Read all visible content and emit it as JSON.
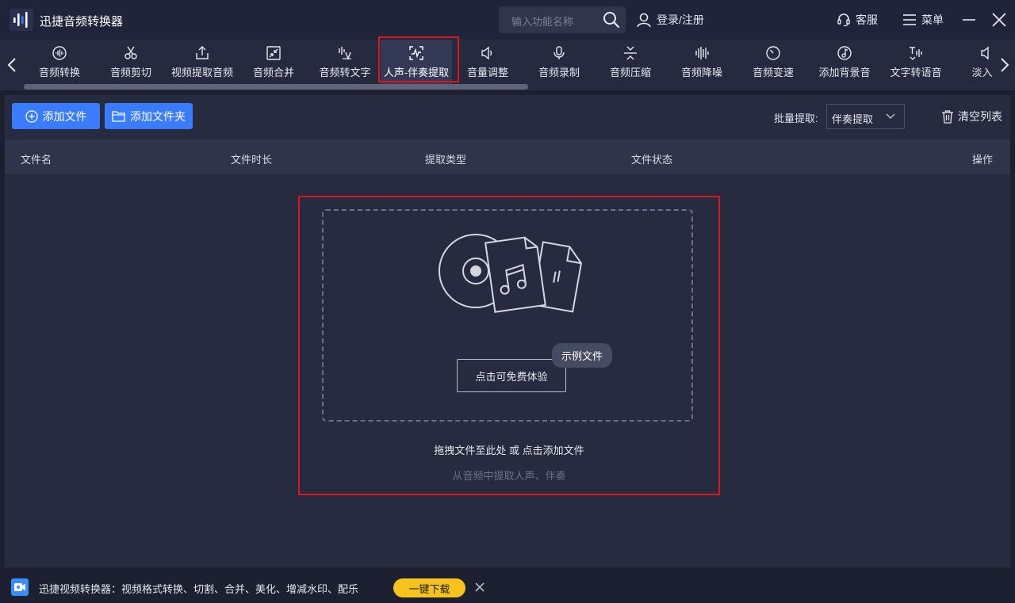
{
  "app": {
    "title": "迅捷音频转换器"
  },
  "titlebar": {
    "search_placeholder": "输入功能名称",
    "login_label": "登录/注册",
    "service_label": "客服",
    "menu_label": "菜单"
  },
  "tools": [
    {
      "label": "音频转换",
      "icon": "waveform-circle-icon"
    },
    {
      "label": "音频剪切",
      "icon": "scissors-icon"
    },
    {
      "label": "视频提取音频",
      "icon": "export-icon"
    },
    {
      "label": "音频合并",
      "icon": "merge-arrows-icon"
    },
    {
      "label": "音频转文字",
      "icon": "audio-to-text-icon"
    },
    {
      "label": "人声-伴奏提取",
      "icon": "voice-extract-icon",
      "active": true
    },
    {
      "label": "音量调整",
      "icon": "speaker-icon"
    },
    {
      "label": "音频录制",
      "icon": "microphone-icon"
    },
    {
      "label": "音频压缩",
      "icon": "compress-icon"
    },
    {
      "label": "音频降噪",
      "icon": "noise-bars-icon"
    },
    {
      "label": "音频变速",
      "icon": "speedometer-icon"
    },
    {
      "label": "添加背景音",
      "icon": "music-note-circle-icon"
    },
    {
      "label": "文字转语音",
      "icon": "text-to-speech-icon"
    },
    {
      "label": "淡入淡",
      "icon": "fade-icon"
    }
  ],
  "actions": {
    "add_file": "添加文件",
    "add_folder": "添加文件夹",
    "batch_label": "批量提取:",
    "batch_value": "伴奏提取",
    "clear_list": "清空列表"
  },
  "table": {
    "headers": [
      "文件名",
      "文件时长",
      "提取类型",
      "文件状态",
      "操作"
    ]
  },
  "dropzone": {
    "try_button": "点击可免费体验",
    "sample_tag": "示例文件",
    "hint": "拖拽文件至此处 或 点击添加文件",
    "sub_hint": "从音频中提取人声、伴奏"
  },
  "footer": {
    "promo_text": "迅捷视频转换器：视频格式转换、切割、合并、美化、增减水印、配乐",
    "download_button": "一键下载"
  },
  "colors": {
    "accent": "#3a7cff",
    "highlight": "#e0141c",
    "download": "#f7c21c"
  }
}
